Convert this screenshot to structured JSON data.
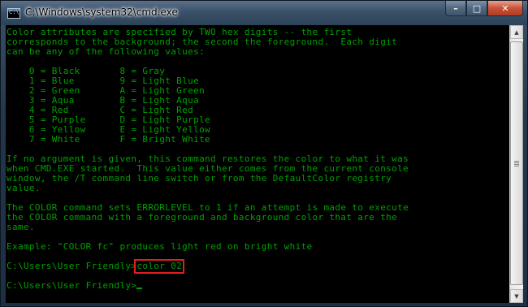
{
  "window": {
    "title": "C:\\Windows\\system32\\cmd.exe",
    "icon": "cmd-console-icon",
    "icon_prompt": "C:\\",
    "buttons": {
      "minimize_glyph": "–",
      "maximize_glyph": "□",
      "close_glyph": "✕"
    }
  },
  "console": {
    "text_color": "#00a000",
    "background": "#000000",
    "intro": [
      "Color attributes are specified by TWO hex digits -- the first",
      "corresponds to the background; the second the foreground.  Each digit",
      "can be any of the following values:"
    ],
    "color_table": [
      "    0 = Black       8 = Gray",
      "    1 = Blue        9 = Light Blue",
      "    2 = Green       A = Light Green",
      "    3 = Aqua        B = Light Aqua",
      "    4 = Red         C = Light Red",
      "    5 = Purple      D = Light Purple",
      "    6 = Yellow      E = Light Yellow",
      "    7 = White       F = Bright White"
    ],
    "paragraph_default": [
      "If no argument is given, this command restores the color to what it was",
      "when CMD.EXE started.  This value either comes from the current console",
      "window, the /T command line switch or from the DefaultColor registry",
      "value."
    ],
    "paragraph_errorlevel": [
      "The COLOR command sets ERRORLEVEL to 1 if an attempt is made to execute",
      "the COLOR command with a foreground and background color that are the",
      "same."
    ],
    "example": "Example: \"COLOR fc\" produces light red on bright white",
    "prompt_1": "C:\\Users\\User Friendly>",
    "command_1": "color 02",
    "highlight_color": "#e02020",
    "prompt_2": "C:\\Users\\User Friendly>"
  },
  "scrollbar": {
    "up_glyph": "▲",
    "down_glyph": "▼"
  }
}
